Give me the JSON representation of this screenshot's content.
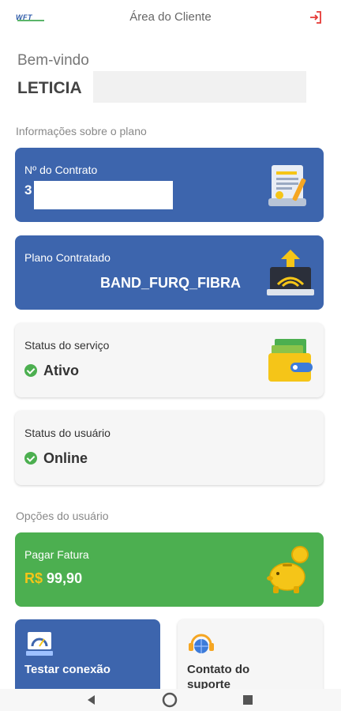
{
  "header": {
    "logo_text": "WFT",
    "title": "Área do Cliente",
    "logout_icon": "logout-icon"
  },
  "welcome": {
    "greeting": "Bem-vindo",
    "name": "LETICIA"
  },
  "plan_section": {
    "label": "Informações sobre o plano",
    "contract": {
      "title": "Nº do Contrato",
      "number": "3",
      "icon": "contract-document-icon"
    },
    "plan": {
      "title": "Plano Contratado",
      "value": "BAND_FURQ_FIBRA",
      "icon": "router-upload-icon"
    },
    "service_status": {
      "title": "Status do serviço",
      "value": "Ativo",
      "icon": "wallet-icon"
    },
    "user_status": {
      "title": "Status do usuário",
      "value": "Online",
      "icon": "check-circle-icon"
    }
  },
  "user_options": {
    "label": "Opções do usuário",
    "pay_invoice": {
      "title": "Pagar Fatura",
      "currency": "R$",
      "amount": "99,90",
      "icon": "piggy-bank-icon"
    },
    "test_connection": {
      "title": "Testar conexão",
      "icon": "speed-test-icon"
    },
    "support_contact": {
      "title": "Contato do suporte",
      "icon": "headset-globe-icon"
    }
  },
  "colors": {
    "primary_blue": "#3d65ad",
    "success_green": "#4caf50",
    "accent_yellow": "#f5c518"
  }
}
